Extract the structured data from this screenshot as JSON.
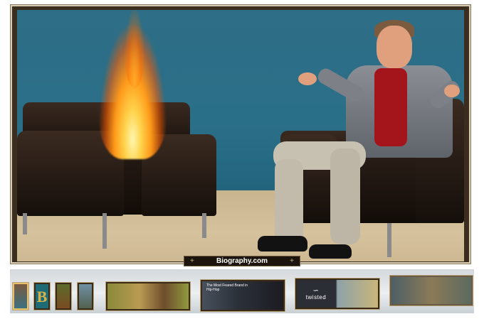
{
  "viewer": {
    "caption_prev": "+",
    "caption_text": "Biography.com",
    "caption_next": "+"
  },
  "thumbnails": {
    "t2_glyph": "B",
    "t6_text": "The Most Feared Brand in Hip-Hop",
    "t7_logo": "twisted",
    "t7_logo_mark": "∽"
  }
}
